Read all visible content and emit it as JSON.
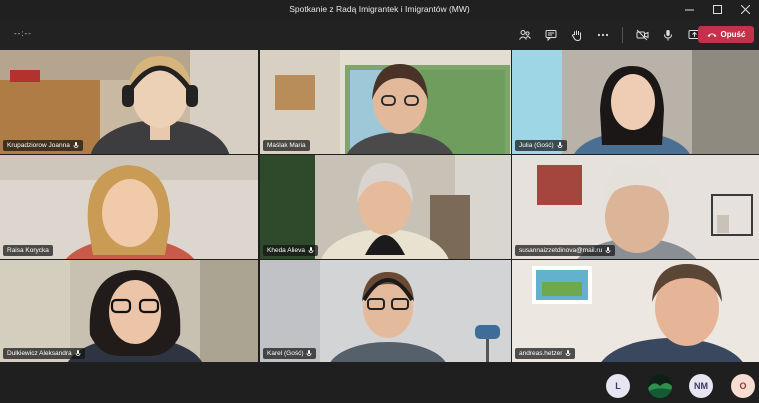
{
  "window": {
    "title": "Spotkanie z Radą Imigrantek i Imigrantów (MW)"
  },
  "toolbar": {
    "timer": "--:--",
    "leave_label": "Opuść"
  },
  "participants": [
    {
      "name": "Krupadziorow Joanna"
    },
    {
      "name": "Maślak Maria"
    },
    {
      "name": "Julia (Gość)"
    },
    {
      "name": "Raisa Korycka"
    },
    {
      "name": "Kheda Alieva"
    },
    {
      "name": "susannaizzetdinova@mail.ru"
    },
    {
      "name": "Dulkiewicz Aleksandra"
    },
    {
      "name": "Karel (Gość)"
    },
    {
      "name": "andreas.hetzer"
    }
  ],
  "overflow_avatars": [
    {
      "initials": "L",
      "color": "#e6e6f3"
    },
    {
      "initials": "",
      "color": "#1b3d2c"
    },
    {
      "initials": "NM",
      "color": "#e6e6f3"
    },
    {
      "initials": "O",
      "color": "#f6dcd3"
    }
  ],
  "colors": {
    "leave": "#c4314b",
    "background": "#1f1f1f"
  }
}
